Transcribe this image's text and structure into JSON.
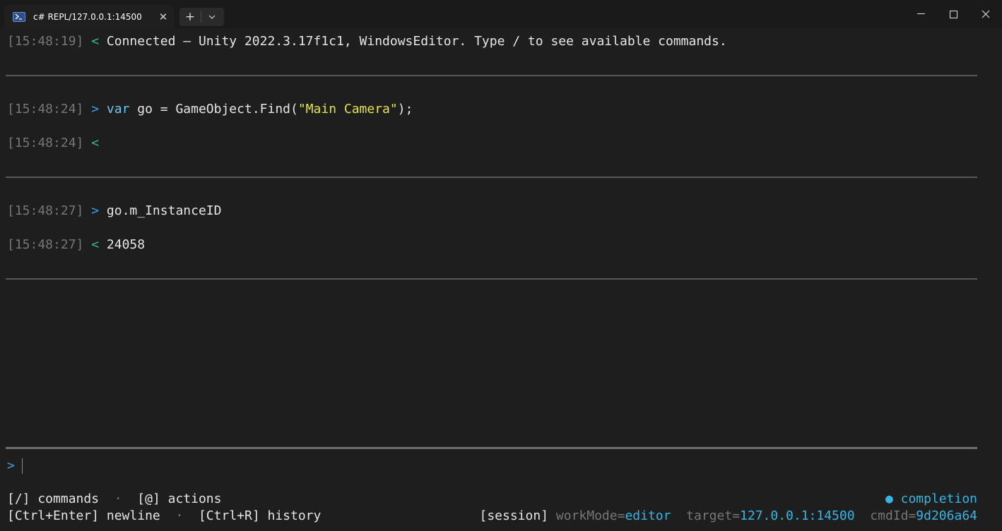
{
  "window": {
    "tab_title": "c# REPL/127.0.0.1:14500",
    "close_glyph": "✕",
    "new_tab_glyph": "+",
    "minimize_icon": "minimize-icon",
    "maximize_icon": "maximize-icon",
    "close_icon": "close-icon"
  },
  "colors": {
    "background": "#1e1e1e",
    "timestamp": "#767676",
    "input_prompt": "#3ba0e0",
    "output_prompt": "#2fbf7a",
    "keyword": "#6cc7f0",
    "string": "#e5e33f",
    "accent": "#34b6e6"
  },
  "log": {
    "entry1": {
      "ts": "[15:48:19]",
      "prompt": "<",
      "text": "Connected — Unity 2022.3.17f1c1, WindowsEditor. Type / to see available commands."
    },
    "entry2": {
      "ts": "[15:48:24]",
      "prompt": ">",
      "kw": "var",
      "code_a": " go = GameObject.Find(",
      "str": "\"Main Camera\"",
      "code_b": ");"
    },
    "entry3": {
      "ts": "[15:48:24]",
      "prompt": "<",
      "text": ""
    },
    "entry4": {
      "ts": "[15:48:27]",
      "prompt": ">",
      "text": "go.m_InstanceID"
    },
    "entry5": {
      "ts": "[15:48:27]",
      "prompt": "<",
      "text": "24058"
    }
  },
  "input": {
    "prompt": ">",
    "value": ""
  },
  "footer": {
    "commands_hint": "[/] commands",
    "sep": "·",
    "actions_hint": "[@] actions",
    "newline_hint": "[Ctrl+Enter] newline",
    "history_hint": "[Ctrl+R] history",
    "completion_dot": "●",
    "completion_label": "completion",
    "session_label": "[session]",
    "workmode_key": "workMode=",
    "workmode_value": "editor",
    "target_key": "target=",
    "target_value": "127.0.0.1:14500",
    "cmdid_key": "cmdId=",
    "cmdid_value": "9d206a64"
  }
}
